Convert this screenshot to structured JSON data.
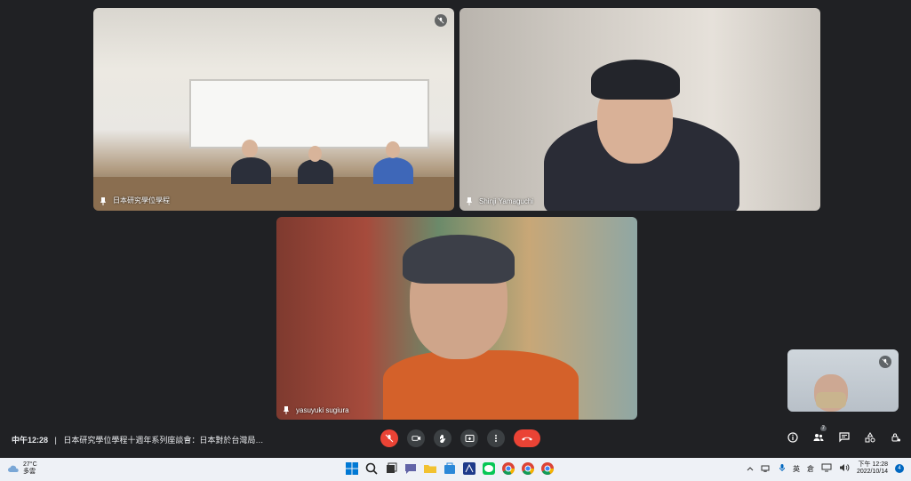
{
  "tiles": {
    "room": {
      "name": "日本研究學位學程"
    },
    "speaker2": {
      "name": "Shinji Yamaguchi"
    },
    "speaker3": {
      "name": "yasuyuki sugiura"
    }
  },
  "meeting": {
    "time": "中午12:28",
    "separator": "|",
    "title": "日本研究學位學程十週年系列座談會：日本對於台灣局…"
  },
  "participants_count": "7",
  "taskbar": {
    "weather_temp": "27°C",
    "weather_desc": "多雲",
    "ime": "英",
    "ime2": "倉",
    "clock_time": "下午 12:28",
    "clock_date": "2022/10/14",
    "notifications": "4"
  }
}
